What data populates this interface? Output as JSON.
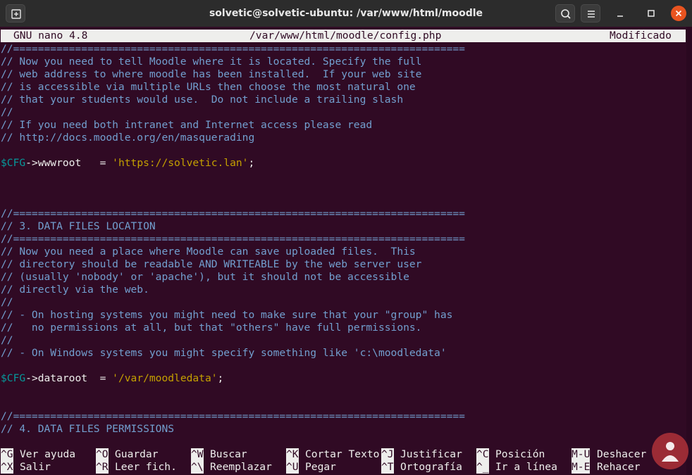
{
  "window": {
    "title": "solvetic@solvetic-ubuntu: /var/www/html/moodle"
  },
  "nano": {
    "version": "GNU nano 4.8",
    "file": "/var/www/html/moodle/config.php",
    "status": "Modificado"
  },
  "editor": {
    "lines": [
      "//=========================================================================",
      "// Now you need to tell Moodle where it is located. Specify the full",
      "// web address to where moodle has been installed.  If your web site",
      "// is accessible via multiple URLs then choose the most natural one",
      "// that your students would use.  Do not include a trailing slash",
      "//",
      "// If you need both intranet and Internet access please read",
      "// http://docs.moodle.org/en/masquerading",
      "",
      "$CFG->wwwroot   = 'https://solvetic.lan';",
      "",
      "",
      "",
      "//=========================================================================",
      "// 3. DATA FILES LOCATION",
      "//=========================================================================",
      "// Now you need a place where Moodle can save uploaded files.  This",
      "// directory should be readable AND WRITEABLE by the web server user",
      "// (usually 'nobody' or 'apache'), but it should not be accessible",
      "// directly via the web.",
      "//",
      "// - On hosting systems you might need to make sure that your \"group\" has",
      "//   no permissions at all, but that \"others\" have full permissions.",
      "//",
      "// - On Windows systems you might specify something like 'c:\\moodledata'",
      "",
      "$CFG->dataroot  = '/var/moodledata';",
      "",
      "",
      "//=========================================================================",
      "// 4. DATA FILES PERMISSIONS"
    ]
  },
  "shortcuts": [
    {
      "key": "^G",
      "label": "Ver ayuda"
    },
    {
      "key": "^O",
      "label": "Guardar"
    },
    {
      "key": "^W",
      "label": "Buscar"
    },
    {
      "key": "^K",
      "label": "Cortar Texto"
    },
    {
      "key": "^J",
      "label": "Justificar"
    },
    {
      "key": "^C",
      "label": "Posición"
    },
    {
      "key": "M-U",
      "label": "Deshacer"
    },
    {
      "key": "^X",
      "label": "Salir"
    },
    {
      "key": "^R",
      "label": "Leer fich."
    },
    {
      "key": "^\\",
      "label": "Reemplazar"
    },
    {
      "key": "^U",
      "label": "Pegar"
    },
    {
      "key": "^T",
      "label": "Ortografía"
    },
    {
      "key": "^_",
      "label": "Ir a línea"
    },
    {
      "key": "M-E",
      "label": "Rehacer"
    }
  ],
  "colors": {
    "background": "#300a24",
    "comment": "#729fcf",
    "variable": "#06989a",
    "string": "#c4a000",
    "close": "#e95420"
  }
}
